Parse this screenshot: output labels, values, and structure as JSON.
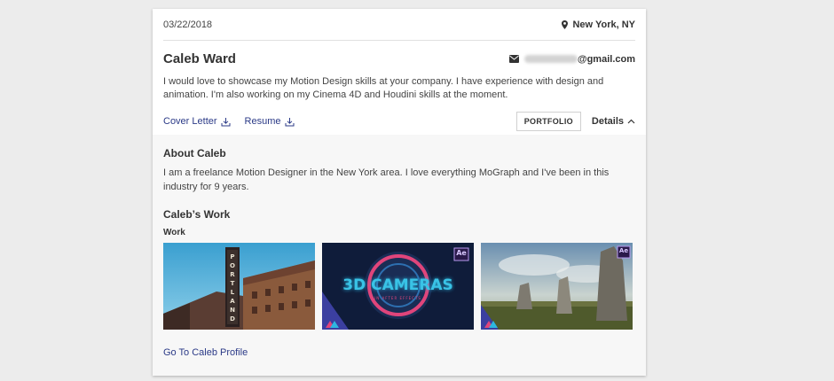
{
  "header": {
    "date": "03/22/2018",
    "location": "New York, NY"
  },
  "candidate": {
    "name": "Caleb Ward",
    "email_domain": "@gmail.com",
    "bio": "I would love to showcase my Motion Design skills at your company. I have experience with design and animation. I'm also working on my Cinema 4D and Houdini skills at the moment."
  },
  "actions": {
    "cover_letter": "Cover Letter",
    "resume": "Resume",
    "portfolio": "PORTFOLIO",
    "details": "Details"
  },
  "about": {
    "title": "About Caleb",
    "text": "I am a freelance Motion Designer in the New York area. I love everything MoGraph and I've been in this industry for 9 years."
  },
  "work": {
    "title": "Caleb’s Work",
    "subtitle": "Work",
    "thumbnails": [
      {
        "badge": ""
      },
      {
        "title": "3D CAMERAS",
        "caption": "IN AFTER EFFECTS",
        "badge": "Ae"
      },
      {
        "badge": "Ae"
      }
    ]
  },
  "footer": {
    "profile_link": "Go To Caleb Profile"
  },
  "colors": {
    "link": "#2b3a87",
    "panel_bg": "#f7f7f7",
    "accent_pink": "#e0457b"
  }
}
